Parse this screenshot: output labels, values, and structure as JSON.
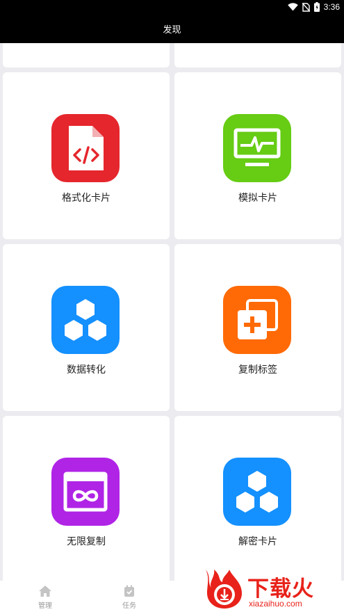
{
  "status_bar": {
    "time": "3:36"
  },
  "app_bar": {
    "title": "发现"
  },
  "cards": [
    {
      "label": "格式化卡片",
      "icon": "code-file-icon",
      "color": "#e5262d"
    },
    {
      "label": "模拟卡片",
      "icon": "monitor-pulse-icon",
      "color": "#66cc14"
    },
    {
      "label": "数据转化",
      "icon": "hexagons-icon",
      "color": "#1490ff"
    },
    {
      "label": "复制标签",
      "icon": "copy-plus-icon",
      "color": "#ff6a06"
    },
    {
      "label": "无限复制",
      "icon": "infinity-window-icon",
      "color": "#b024e6"
    },
    {
      "label": "解密卡片",
      "icon": "hexagons-icon",
      "color": "#1490ff"
    }
  ],
  "bottom_nav": {
    "items": [
      {
        "label": "管理",
        "icon": "home-icon"
      },
      {
        "label": "任务",
        "icon": "task-icon"
      }
    ]
  },
  "watermark": {
    "text": "下载火",
    "url": "xiazaihuo.com"
  }
}
